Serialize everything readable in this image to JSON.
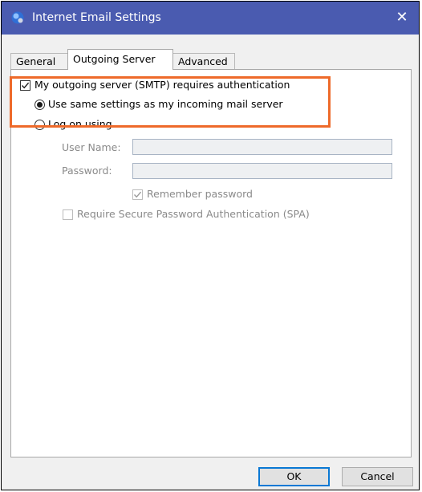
{
  "window": {
    "title": "Internet Email Settings",
    "close_glyph": "✕",
    "title_icon": "mail-settings-icon"
  },
  "tabs": [
    {
      "label": "General",
      "active": false
    },
    {
      "label": "Outgoing Server",
      "active": true
    },
    {
      "label": "Advanced",
      "active": false
    }
  ],
  "outgoing": {
    "requires_auth_label": "My outgoing server (SMTP) requires authentication",
    "requires_auth_checked": true,
    "use_same_label": "Use same settings as my incoming mail server",
    "use_same_selected": true,
    "log_on_label": "Log on using",
    "log_on_selected": false,
    "user_name_label": "User Name:",
    "user_name_value": "",
    "password_label": "Password:",
    "password_value": "",
    "remember_label": "Remember password",
    "remember_checked": true,
    "spa_label": "Require Secure Password Authentication (SPA)",
    "spa_checked": false
  },
  "buttons": {
    "ok": "OK",
    "cancel": "Cancel"
  },
  "colors": {
    "titlebar": "#4a5bb0",
    "highlight": "#ee6a2a",
    "default_button_border": "#0a78d4"
  }
}
